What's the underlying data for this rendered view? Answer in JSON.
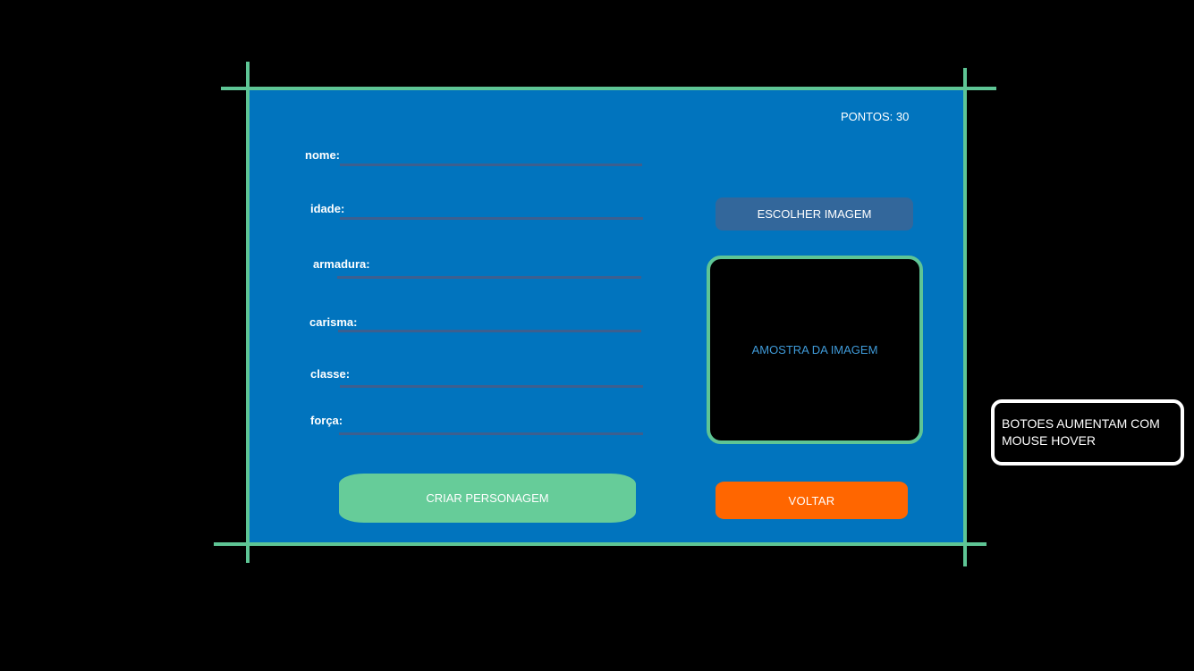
{
  "header": {
    "points_label": "PONTOS: 30"
  },
  "form": {
    "fields": [
      {
        "label": "nome:"
      },
      {
        "label": "idade:"
      },
      {
        "label": "armadura:"
      },
      {
        "label": "carisma:"
      },
      {
        "label": "classe:"
      },
      {
        "label": "força:"
      }
    ]
  },
  "image_panel": {
    "choose_button": "ESCOLHER IMAGEM",
    "preview_text": "AMOSTRA DA IMAGEM"
  },
  "actions": {
    "create_button": "CRIAR PERSONAGEM",
    "back_button": "VOLTAR"
  },
  "annotation": {
    "note": "BOTOES AUMENTAM COM MOUSE HOVER"
  },
  "colors": {
    "panel_background": "#0174be",
    "frame": "#5ec595",
    "choose_button": "#33679b",
    "create_button": "#66cc99",
    "back_button": "#ff6600",
    "preview_text": "#3f9ad8"
  }
}
